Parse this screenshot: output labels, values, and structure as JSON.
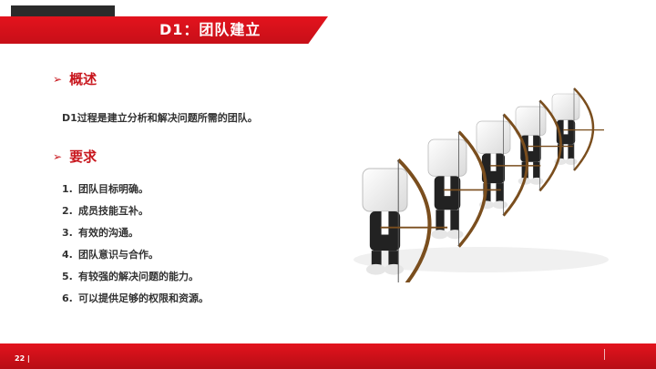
{
  "header": {
    "title": "D1：团队建立"
  },
  "sections": [
    {
      "arrow": "➢",
      "heading": "概述"
    },
    {
      "arrow": "➢",
      "heading": "要求"
    }
  ],
  "overview_text": "D1过程是建立分析和解决问题所需的团队。",
  "requirements": [
    {
      "num": "1.",
      "text": "团队目标明确。"
    },
    {
      "num": "2.",
      "text": "成员技能互补。"
    },
    {
      "num": "3.",
      "text": "有效的沟通。"
    },
    {
      "num": "4.",
      "text": "团队意识与合作。"
    },
    {
      "num": "5.",
      "text": "有较强的解决问题的能力。"
    },
    {
      "num": "6.",
      "text": "可以提供足够的权限和资源。"
    }
  ],
  "footer": {
    "page": "22 |"
  },
  "colors": {
    "accent": "#c8161d",
    "dark": "#2b2b2b",
    "text": "#333333"
  },
  "illustration": {
    "icon": "archers-team-icon"
  }
}
